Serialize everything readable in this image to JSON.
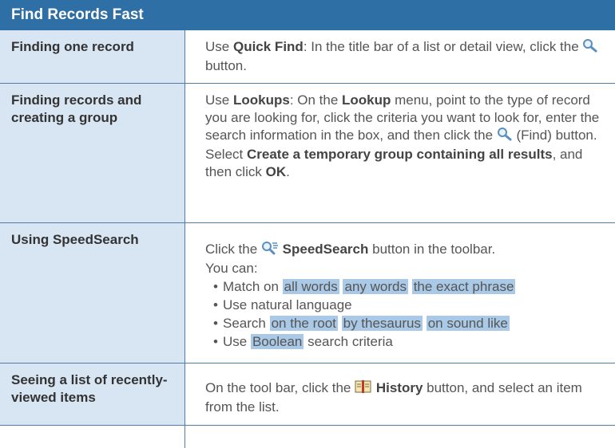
{
  "title": "Find Records Fast",
  "rows": [
    {
      "label": "Finding one record",
      "t1": "Use ",
      "b1": "Quick Find",
      "t2": ": In the title bar of a list or detail view, click the ",
      "icon": "magnifier-icon",
      "t3": " button."
    },
    {
      "label": "Finding records and creating a group",
      "t1": "Use ",
      "b1": "Lookups",
      "t2": ": On the ",
      "b2": "Lookup",
      "t3": " menu, point to the type of record you are looking for, click the criteria you want to look for, enter the search information in the box, and then click the ",
      "icon": "magnifier-icon",
      "t4": " (Find) button. Select ",
      "b3": "Create a temporary group containing all results",
      "t5": ", and then click ",
      "b4": "OK",
      "t6": "."
    },
    {
      "label": "Using SpeedSearch",
      "t1": "Click the ",
      "icon": "speedsearch-icon",
      "b1": "SpeedSearch",
      "t2": " button in the toolbar.",
      "t3": "You can:",
      "bullets": {
        "b1_pre": "Match on ",
        "b1_h1": "all words",
        "b1_h2": "any words",
        "b1_h3": "the exact phrase",
        "b2": "Use natural language",
        "b3_pre": "Search ",
        "b3_h1": "on the root",
        "b3_h2": "by thesaurus",
        "b3_h3": "on sound like",
        "b4_pre": "Use ",
        "b4_h1": "Boolean",
        "b4_post": " search criteria"
      }
    },
    {
      "label": "Seeing a list of recently-viewed items",
      "t1": "On the tool bar, click the ",
      "icon": "history-book-icon",
      "b1": "History",
      "t2": " button, and select an item from the list."
    }
  ]
}
